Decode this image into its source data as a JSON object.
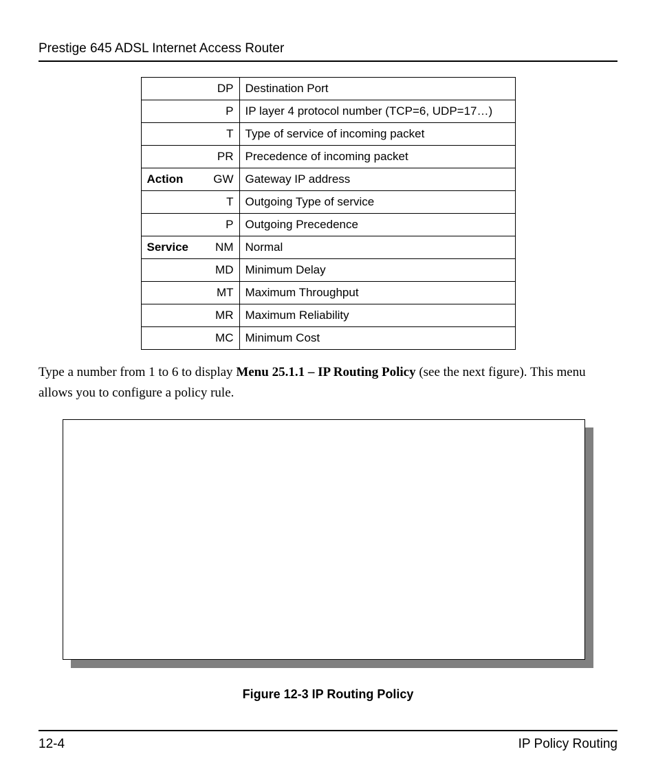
{
  "header": {
    "title": "Prestige 645 ADSL Internet Access Router"
  },
  "table": {
    "rows": [
      {
        "category": "",
        "abbr": "DP",
        "desc": "Destination Port"
      },
      {
        "category": "",
        "abbr": "P",
        "desc": "IP layer 4 protocol number (TCP=6, UDP=17…)"
      },
      {
        "category": "",
        "abbr": "T",
        "desc": "Type of service of incoming packet"
      },
      {
        "category": "",
        "abbr": "PR",
        "desc": "Precedence of incoming packet"
      },
      {
        "category": "Action",
        "abbr": "GW",
        "desc": "Gateway IP address"
      },
      {
        "category": "",
        "abbr": "T",
        "desc": "Outgoing Type of service"
      },
      {
        "category": "",
        "abbr": "P",
        "desc": "Outgoing Precedence"
      },
      {
        "category": "Service",
        "abbr": "NM",
        "desc": "Normal"
      },
      {
        "category": "",
        "abbr": "MD",
        "desc": "Minimum Delay"
      },
      {
        "category": "",
        "abbr": "MT",
        "desc": "Maximum Throughput"
      },
      {
        "category": "",
        "abbr": "MR",
        "desc": "Maximum Reliability"
      },
      {
        "category": "",
        "abbr": "MC",
        "desc": "Minimum Cost"
      }
    ]
  },
  "paragraph": {
    "pre": "Type a number from 1 to 6 to display ",
    "bold": "Menu 25.1.1 – IP Routing Policy",
    "post": " (see the next figure). This menu allows you to configure a policy rule."
  },
  "figure": {
    "caption": "Figure 12-3 IP Routing Policy"
  },
  "footer": {
    "page": "12-4",
    "section": "IP Policy Routing"
  }
}
